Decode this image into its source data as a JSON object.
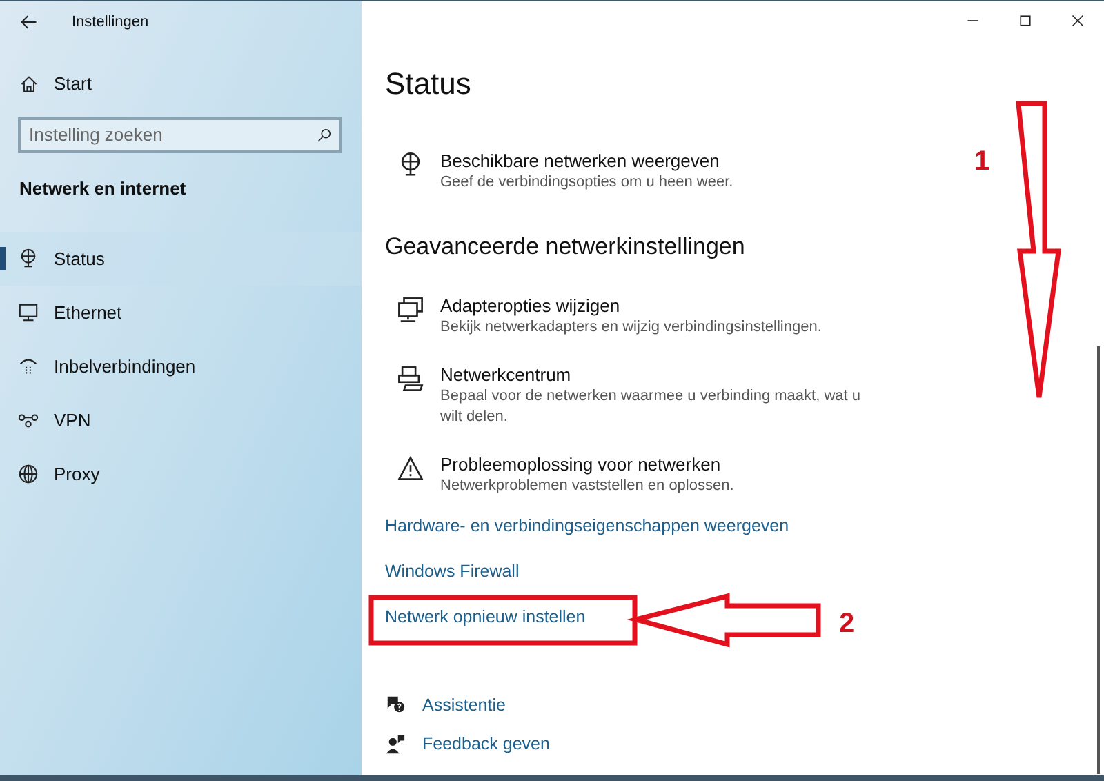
{
  "window": {
    "title": "Instellingen"
  },
  "sidebar": {
    "home": "Start",
    "search": {
      "placeholder": "Instelling zoeken"
    },
    "section": "Netwerk en internet",
    "items": [
      {
        "label": "Status",
        "kind": "status",
        "selected": true
      },
      {
        "label": "Ethernet",
        "kind": "ethernet",
        "selected": false
      },
      {
        "label": "Inbelverbindingen",
        "kind": "dialup",
        "selected": false
      },
      {
        "label": "VPN",
        "kind": "vpn",
        "selected": false
      },
      {
        "label": "Proxy",
        "kind": "proxy",
        "selected": false
      }
    ]
  },
  "main": {
    "title": "Status",
    "top_item": {
      "kind": "globe",
      "title": "Beschikbare netwerken weergeven",
      "description": "Geef de verbindingsopties om u heen weer."
    },
    "heading": "Geavanceerde netwerkinstellingen",
    "items": [
      {
        "kind": "adapter",
        "title": "Adapteropties wijzigen",
        "description": "Bekijk netwerkadapters en wijzig verbindingsinstellingen."
      },
      {
        "kind": "center",
        "title": "Netwerkcentrum",
        "description": "Bepaal voor de netwerken waarmee u verbinding maakt, wat u wilt delen."
      },
      {
        "kind": "warning",
        "title": "Probleemoplossing voor netwerken",
        "description": "Netwerkproblemen vaststellen en oplossen."
      }
    ],
    "links": [
      "Hardware- en verbindingseigenschappen weergeven",
      "Windows Firewall",
      "Netwerk opnieuw instellen"
    ],
    "help": [
      {
        "kind": "assist",
        "label": "Assistentie"
      },
      {
        "kind": "feedback",
        "label": "Feedback geven"
      }
    ]
  },
  "annotations": [
    "1",
    "2"
  ]
}
